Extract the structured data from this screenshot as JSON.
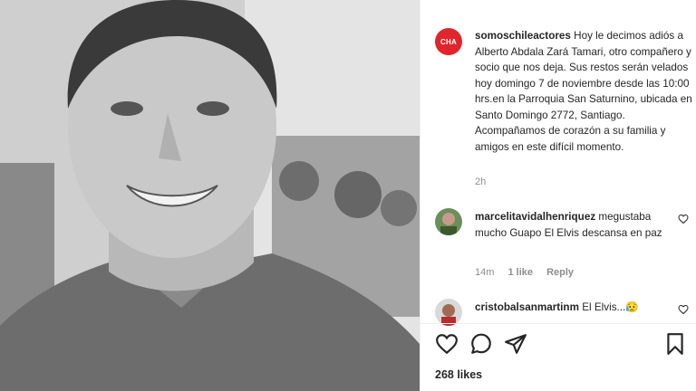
{
  "post": {
    "author": {
      "username": "somoschileactores",
      "avatar_text": "CHA",
      "avatar_color": "#e0252d"
    },
    "caption": "Hoy le decimos adiós a Alberto Abdala Zará Tamari, otro compañero y socio que nos deja. Sus restos serán velados hoy domingo 7 de noviembre desde las 10:00 hrs.en la Parroquia San Saturnino, ubicada en Santo Domingo 2772, Santiago. Acompañamos de corazón a su familia y amigos en este difícil momento.",
    "time": "2h",
    "likes": "268 likes"
  },
  "comments": [
    {
      "username": "marcelitavidalhenriquez",
      "text": "megustaba mucho Guapo El Elvis descansa en paz",
      "time": "14m",
      "likes": "1 like",
      "reply_label": "Reply"
    },
    {
      "username": "cristobalsanmartinm",
      "text": "El Elvis...",
      "emoji": "😥"
    }
  ],
  "actions": {
    "like_icon": "heart-icon",
    "comment_icon": "comment-icon",
    "share_icon": "paper-plane-icon",
    "save_icon": "bookmark-icon"
  }
}
